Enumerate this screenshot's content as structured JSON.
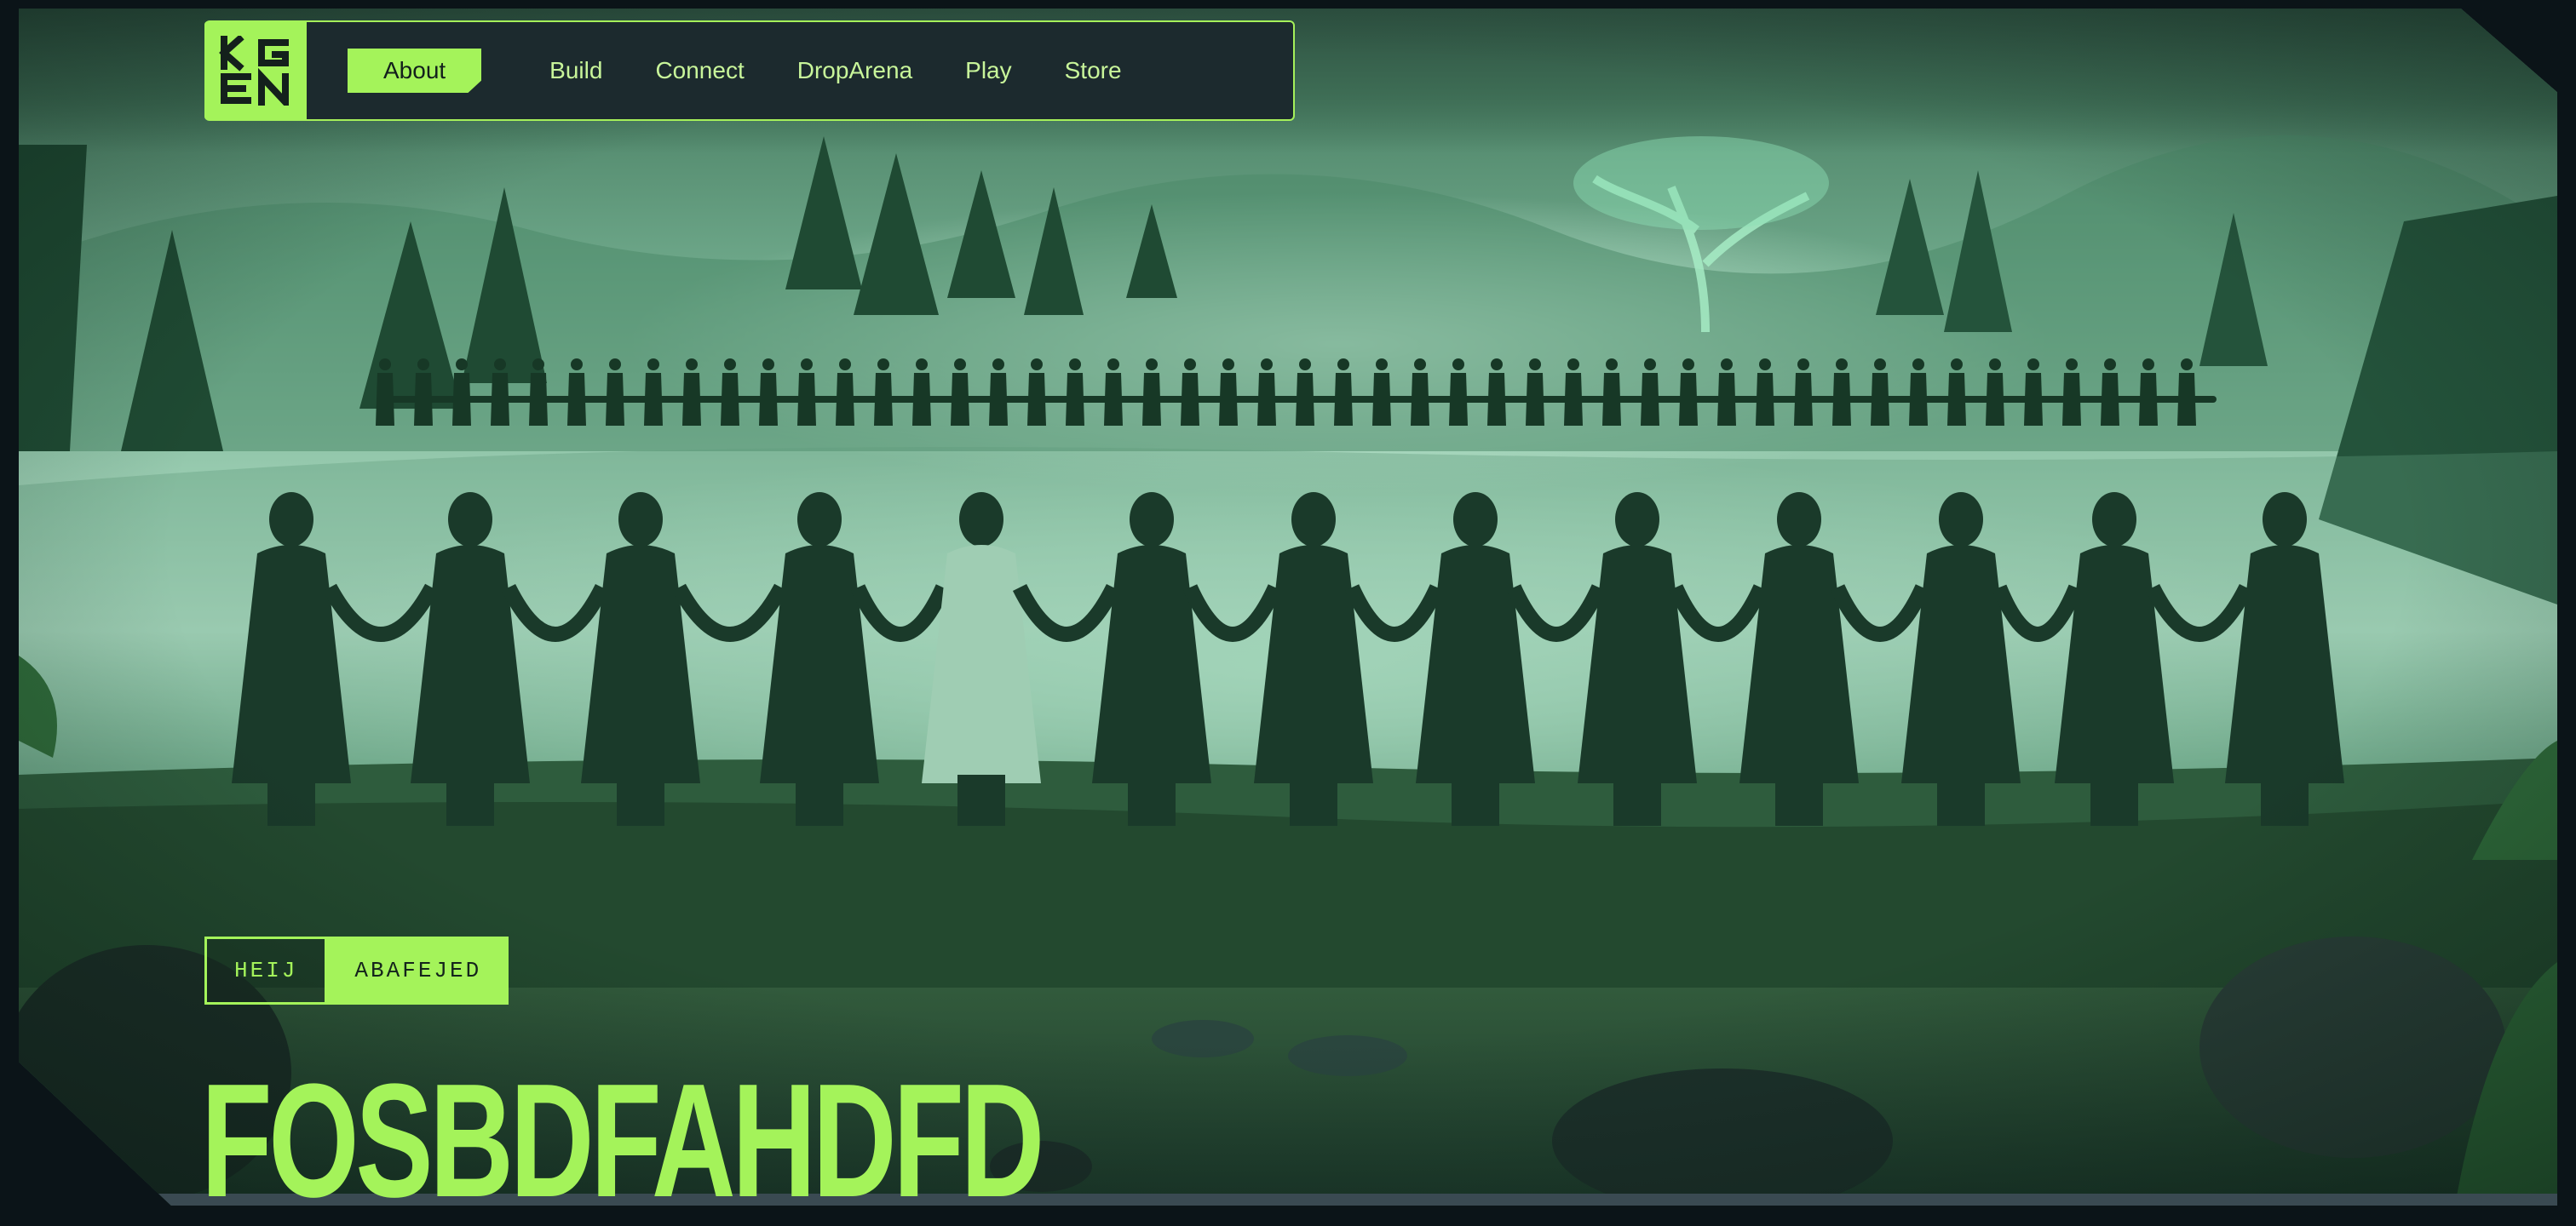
{
  "nav": {
    "logo_icon": "kgen-logo-icon",
    "items": [
      {
        "label": "About",
        "active": true
      },
      {
        "label": "Build",
        "active": false
      },
      {
        "label": "Connect",
        "active": false
      },
      {
        "label": "DropArena",
        "active": false
      },
      {
        "label": "Play",
        "active": false
      },
      {
        "label": "Store",
        "active": false
      }
    ]
  },
  "hero": {
    "tags": [
      "HEIJ",
      "ABAFEJED"
    ],
    "title": "FOSBDFAHDFD",
    "image": "fantasy-characters-holding-hands-forest-image"
  },
  "colors": {
    "accent": "#a4f35a",
    "nav_bg": "#1c2a2e",
    "page_bg": "#0b1418"
  }
}
